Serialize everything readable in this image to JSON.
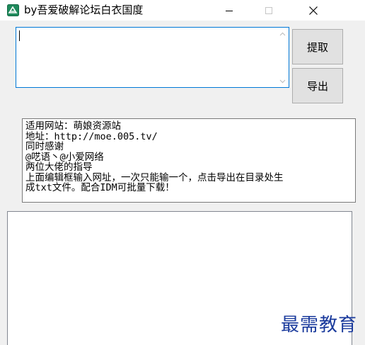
{
  "window": {
    "title": "by吾爱破解论坛白衣国度",
    "icon": "app-logo-icon",
    "controls": {
      "minimize_icon": "minimize-icon",
      "maximize_icon": "maximize-icon",
      "close_icon": "close-icon"
    }
  },
  "input": {
    "value": "",
    "scroll_up_icon": "chevron-up-icon",
    "scroll_down_icon": "chevron-down-icon"
  },
  "buttons": {
    "extract_label": "提取",
    "export_label": "导出"
  },
  "info": {
    "lines": [
      "适用网站：萌娘资源站",
      "地址：http://moe.005.tv/",
      "同时感谢",
      "@呓语丶@小爱网络",
      "两位大佬的指导",
      "上面编辑框输入网址，一次只能输一个，点击导出在目录处生",
      "成txt文件。配合IDM可批量下载！"
    ]
  },
  "output": {
    "value": ""
  },
  "watermark": {
    "text": "最需教育"
  },
  "colors": {
    "focus_border": "#0078d7",
    "window_bg": "#f0f0f0",
    "button_bg": "#e1e1e1",
    "watermark": "#1a3a9c",
    "app_icon": "#1f8a5c"
  }
}
